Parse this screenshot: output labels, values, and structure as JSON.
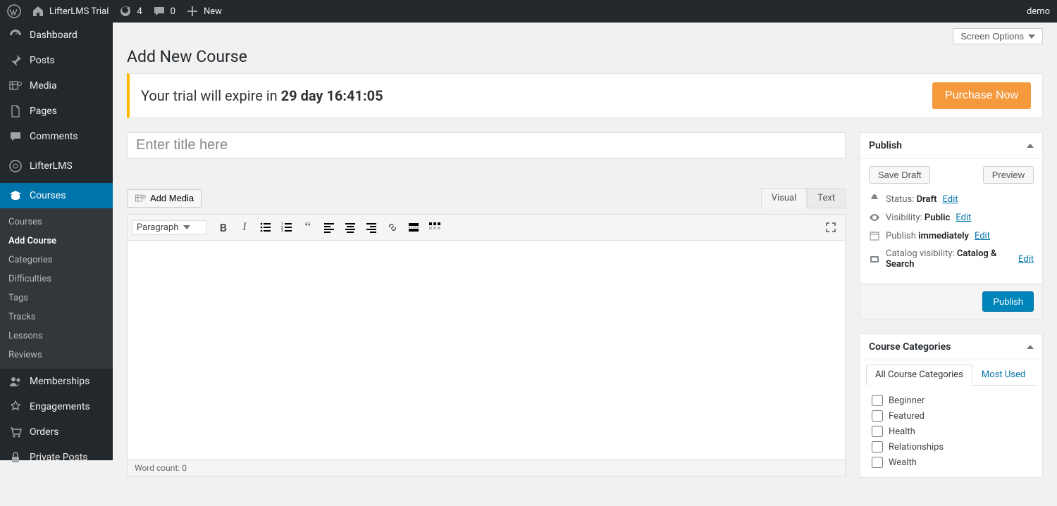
{
  "adminbar": {
    "site_name": "LifterLMS Trial",
    "update_count": "4",
    "comment_count": "0",
    "new_label": "New",
    "user": "demo"
  },
  "sidebar": {
    "items": [
      {
        "label": "Dashboard",
        "icon": "dashboard"
      },
      {
        "label": "Posts",
        "icon": "pin"
      },
      {
        "label": "Media",
        "icon": "media"
      },
      {
        "label": "Pages",
        "icon": "pages"
      },
      {
        "label": "Comments",
        "icon": "comment"
      },
      {
        "label": "LifterLMS",
        "icon": "llms"
      },
      {
        "label": "Courses",
        "icon": "grad",
        "current": true
      },
      {
        "label": "Memberships",
        "icon": "group"
      },
      {
        "label": "Engagements",
        "icon": "engage"
      },
      {
        "label": "Orders",
        "icon": "cart"
      },
      {
        "label": "Private Posts",
        "icon": "lock"
      }
    ],
    "submenu": [
      "Courses",
      "Add Course",
      "Categories",
      "Difficulties",
      "Tags",
      "Tracks",
      "Lessons",
      "Reviews"
    ],
    "submenu_current": "Add Course"
  },
  "screen_options_label": "Screen Options",
  "page_title": "Add New Course",
  "trial": {
    "prefix": "Your trial will expire in ",
    "countdown": "29 day 16:41:05",
    "purchase_label": "Purchase Now"
  },
  "title_placeholder": "Enter title here",
  "editor": {
    "add_media": "Add Media",
    "tabs": {
      "visual": "Visual",
      "text": "Text"
    },
    "format": "Paragraph",
    "word_count_label": "Word count: ",
    "word_count": "0"
  },
  "publish_box": {
    "title": "Publish",
    "save_draft": "Save Draft",
    "preview": "Preview",
    "status_label": "Status:",
    "status_value": "Draft",
    "visibility_label": "Visibility:",
    "visibility_value": "Public",
    "schedule_label": "Publish",
    "schedule_value": "immediately",
    "catalog_label": "Catalog visibility:",
    "catalog_value": "Catalog & Search",
    "edit": "Edit",
    "publish_button": "Publish"
  },
  "categories_box": {
    "title": "Course Categories",
    "tab_all": "All Course Categories",
    "tab_most": "Most Used",
    "items": [
      "Beginner",
      "Featured",
      "Health",
      "Relationships",
      "Wealth"
    ]
  }
}
